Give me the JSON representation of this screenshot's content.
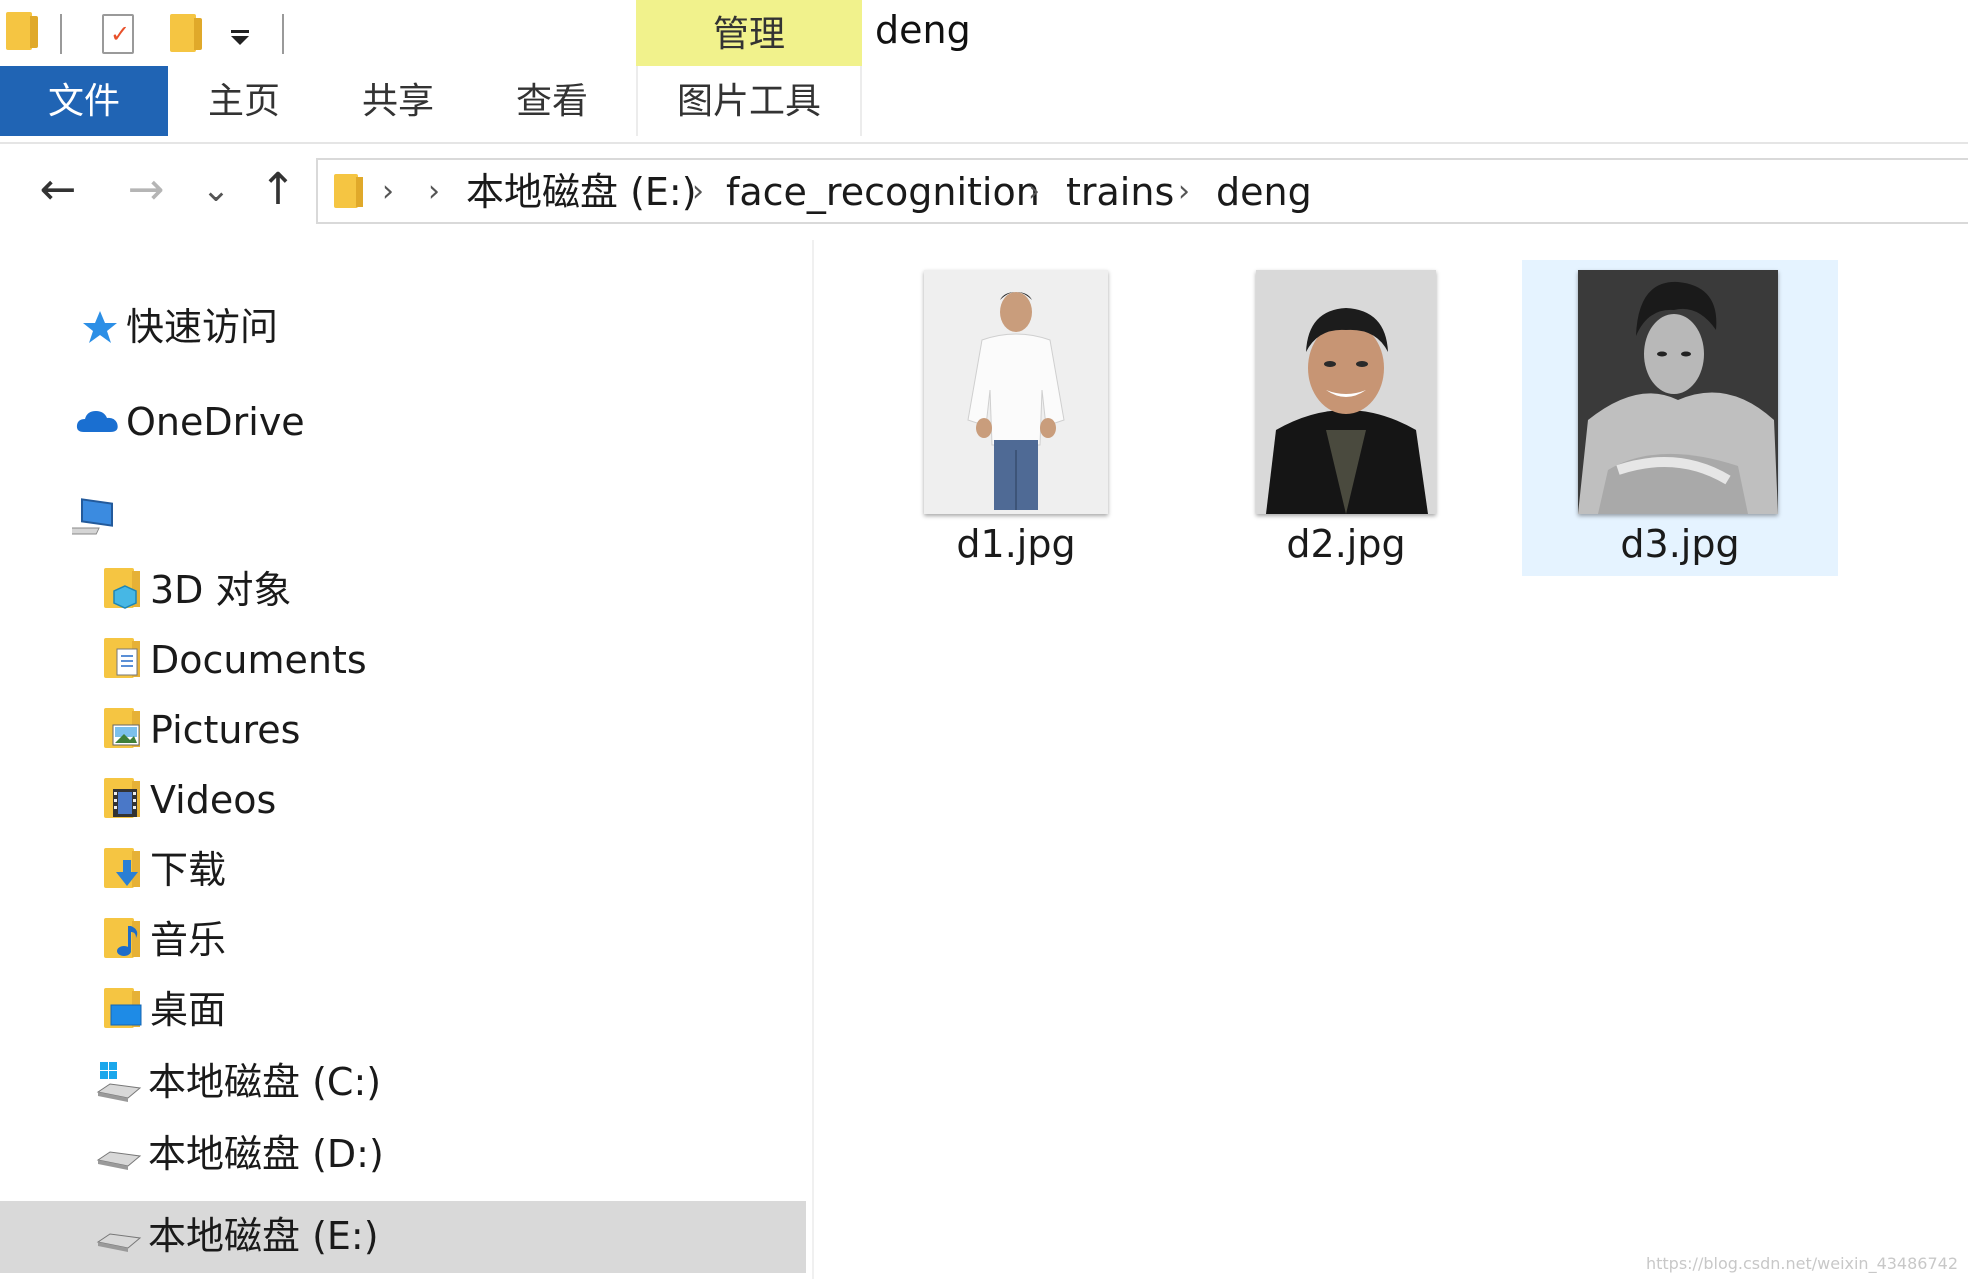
{
  "quick_access": {
    "icons": [
      "folder-icon",
      "properties-icon",
      "new-folder-icon",
      "customize-dropdown-icon"
    ]
  },
  "contextual_tab": {
    "label": "管理"
  },
  "window_title": "deng",
  "ribbon": {
    "tabs": [
      {
        "label": "文件",
        "active": true
      },
      {
        "label": "主页"
      },
      {
        "label": "共享"
      },
      {
        "label": "查看"
      },
      {
        "label": "图片工具"
      }
    ]
  },
  "nav_buttons": {
    "back": "←",
    "forward": "→",
    "recent": "⌄",
    "up": "↑"
  },
  "breadcrumb": [
    "本地磁盘 (E:)",
    "face_recognition",
    "trains",
    "deng"
  ],
  "sidebar": {
    "quick_access": "快速访问",
    "onedrive": "OneDrive",
    "this_pc_items": [
      {
        "label": "3D 对象",
        "icon": "3d-objects-icon"
      },
      {
        "label": "Documents",
        "icon": "documents-icon"
      },
      {
        "label": "Pictures",
        "icon": "pictures-icon"
      },
      {
        "label": "Videos",
        "icon": "videos-icon"
      },
      {
        "label": "下载",
        "icon": "downloads-icon"
      },
      {
        "label": "音乐",
        "icon": "music-icon"
      },
      {
        "label": "桌面",
        "icon": "desktop-icon"
      },
      {
        "label": "本地磁盘 (C:)",
        "icon": "drive-c-icon"
      },
      {
        "label": "本地磁盘 (D:)",
        "icon": "drive-d-icon"
      },
      {
        "label": "本地磁盘 (E:)",
        "icon": "drive-e-icon",
        "selected": true
      }
    ]
  },
  "files": [
    {
      "name": "d1.jpg",
      "selected": false
    },
    {
      "name": "d2.jpg",
      "selected": false
    },
    {
      "name": "d3.jpg",
      "selected": true
    }
  ],
  "watermark": "https://blog.csdn.net/weixin_43486742",
  "colors": {
    "file_tab": "#2064b4",
    "contextual_tab": "#f1f28c",
    "selection": "#e5f3ff",
    "nav_selection": "#d9d9d9"
  }
}
